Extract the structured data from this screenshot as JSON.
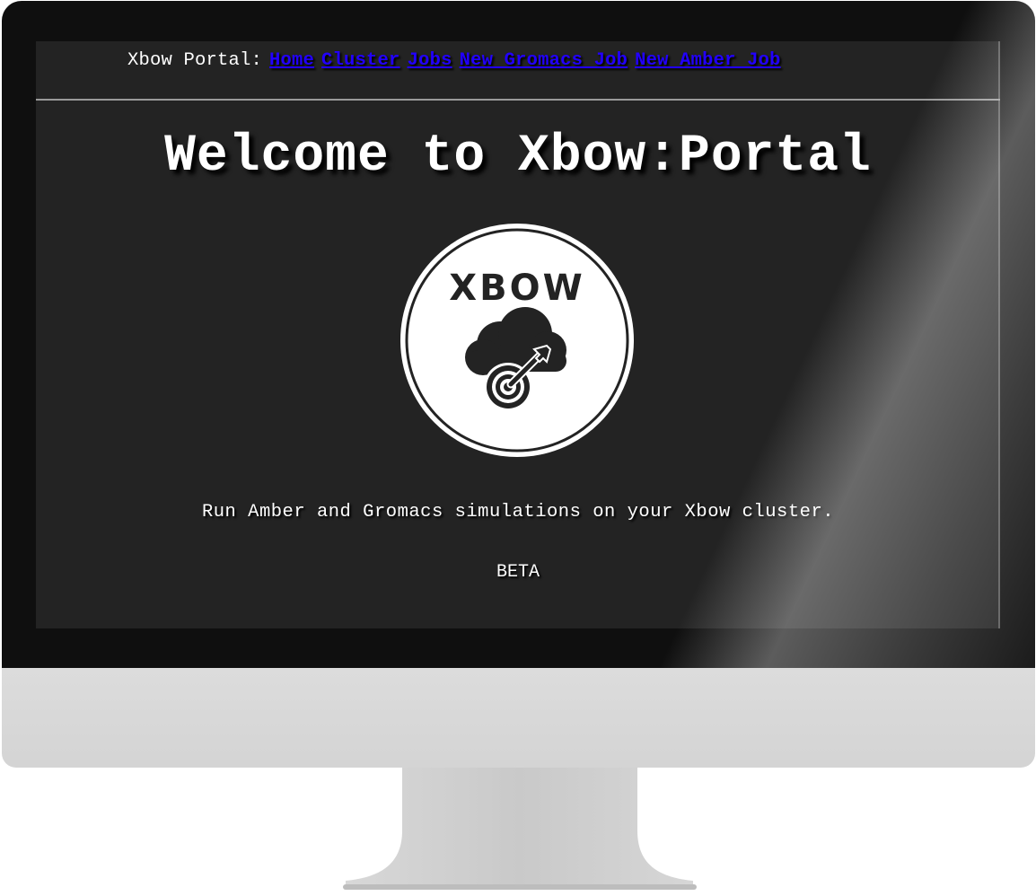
{
  "nav": {
    "label": "Xbow Portal:",
    "links": [
      "Home",
      "Cluster",
      "Jobs",
      "New Gromacs Job",
      "New Amber Job"
    ]
  },
  "main": {
    "heading": "Welcome to Xbow:Portal",
    "logo_text": "XBOW",
    "tagline": "Run Amber and Gromacs simulations on your Xbow cluster.",
    "status": "BETA"
  },
  "icons": {
    "logo": "xbow-cloud-target-logo-icon"
  },
  "colors": {
    "screen_bg": "#232323",
    "link": "#2200ff",
    "text": "#ffffff"
  }
}
